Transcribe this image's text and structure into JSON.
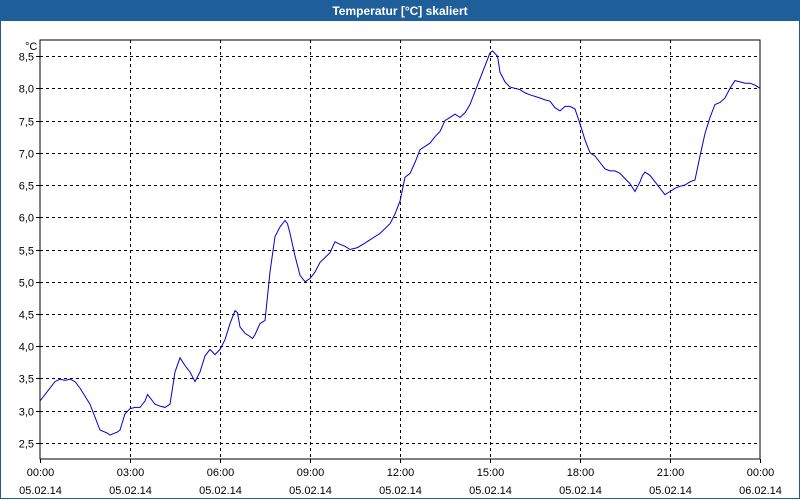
{
  "window": {
    "title": "Temperatur [°C] skaliert"
  },
  "chart_data": {
    "type": "line",
    "title": "Temperatur [°C] skaliert",
    "ylabel": "°C",
    "xlabel": "",
    "ylim": [
      2.25,
      8.75
    ],
    "xlim": [
      "05.02.14 00:00",
      "06.02.14 00:00"
    ],
    "grid": true,
    "yticks": [
      "2,5",
      "3,0",
      "3,5",
      "4,0",
      "4,5",
      "5,0",
      "5,5",
      "6,0",
      "6,5",
      "7,0",
      "7,5",
      "8,0",
      "8,5"
    ],
    "xticks": [
      {
        "time": "00:00",
        "date": "05.02.14"
      },
      {
        "time": "03:00",
        "date": "05.02.14"
      },
      {
        "time": "06:00",
        "date": "05.02.14"
      },
      {
        "time": "09:00",
        "date": "05.02.14"
      },
      {
        "time": "12:00",
        "date": "05.02.14"
      },
      {
        "time": "15:00",
        "date": "05.02.14"
      },
      {
        "time": "18:00",
        "date": "05.02.14"
      },
      {
        "time": "21:00",
        "date": "05.02.14"
      },
      {
        "time": "00:00",
        "date": "06.02.14"
      }
    ],
    "series": [
      {
        "color": "#0000cc",
        "points": [
          [
            "00:00",
            3.15
          ],
          [
            "00:15",
            3.3
          ],
          [
            "00:30",
            3.45
          ],
          [
            "00:40",
            3.49
          ],
          [
            "00:50",
            3.47
          ],
          [
            "01:00",
            3.49
          ],
          [
            "01:10",
            3.45
          ],
          [
            "01:20",
            3.35
          ],
          [
            "01:40",
            3.1
          ],
          [
            "02:00",
            2.7
          ],
          [
            "02:15",
            2.65
          ],
          [
            "02:20",
            2.62
          ],
          [
            "02:35",
            2.67
          ],
          [
            "02:40",
            2.7
          ],
          [
            "02:50",
            2.95
          ],
          [
            "03:00",
            3.03
          ],
          [
            "03:10",
            3.05
          ],
          [
            "03:20",
            3.05
          ],
          [
            "03:30",
            3.15
          ],
          [
            "03:35",
            3.25
          ],
          [
            "03:50",
            3.1
          ],
          [
            "04:00",
            3.07
          ],
          [
            "04:10",
            3.05
          ],
          [
            "04:20",
            3.1
          ],
          [
            "04:30",
            3.6
          ],
          [
            "04:40",
            3.82
          ],
          [
            "04:50",
            3.7
          ],
          [
            "05:00",
            3.6
          ],
          [
            "05:10",
            3.45
          ],
          [
            "05:20",
            3.6
          ],
          [
            "05:30",
            3.85
          ],
          [
            "05:40",
            3.95
          ],
          [
            "05:50",
            3.87
          ],
          [
            "06:00",
            3.95
          ],
          [
            "06:10",
            4.1
          ],
          [
            "06:20",
            4.35
          ],
          [
            "06:30",
            4.55
          ],
          [
            "06:35",
            4.52
          ],
          [
            "06:40",
            4.3
          ],
          [
            "06:50",
            4.2
          ],
          [
            "07:00",
            4.15
          ],
          [
            "07:05",
            4.12
          ],
          [
            "07:10",
            4.18
          ],
          [
            "07:20",
            4.35
          ],
          [
            "07:30",
            4.4
          ],
          [
            "07:40",
            5.15
          ],
          [
            "07:50",
            5.7
          ],
          [
            "08:00",
            5.85
          ],
          [
            "08:10",
            5.95
          ],
          [
            "08:15",
            5.9
          ],
          [
            "08:20",
            5.75
          ],
          [
            "08:30",
            5.4
          ],
          [
            "08:40",
            5.1
          ],
          [
            "08:50",
            5.0
          ],
          [
            "09:00",
            5.05
          ],
          [
            "09:10",
            5.15
          ],
          [
            "09:20",
            5.3
          ],
          [
            "09:40",
            5.45
          ],
          [
            "09:50",
            5.62
          ],
          [
            "10:00",
            5.58
          ],
          [
            "10:10",
            5.55
          ],
          [
            "10:20",
            5.5
          ],
          [
            "10:35",
            5.53
          ],
          [
            "10:50",
            5.6
          ],
          [
            "11:00",
            5.65
          ],
          [
            "11:20",
            5.75
          ],
          [
            "11:40",
            5.9
          ],
          [
            "11:50",
            6.05
          ],
          [
            "12:00",
            6.25
          ],
          [
            "12:10",
            6.62
          ],
          [
            "12:20",
            6.68
          ],
          [
            "12:30",
            6.85
          ],
          [
            "12:40",
            7.05
          ],
          [
            "12:50",
            7.1
          ],
          [
            "13:00",
            7.15
          ],
          [
            "13:10",
            7.25
          ],
          [
            "13:20",
            7.33
          ],
          [
            "13:30",
            7.5
          ],
          [
            "13:40",
            7.55
          ],
          [
            "13:50",
            7.6
          ],
          [
            "14:00",
            7.55
          ],
          [
            "14:10",
            7.62
          ],
          [
            "14:20",
            7.75
          ],
          [
            "14:30",
            7.95
          ],
          [
            "14:40",
            8.15
          ],
          [
            "14:50",
            8.35
          ],
          [
            "15:00",
            8.55
          ],
          [
            "15:05",
            8.58
          ],
          [
            "15:15",
            8.5
          ],
          [
            "15:20",
            8.25
          ],
          [
            "15:30",
            8.1
          ],
          [
            "15:40",
            8.02
          ],
          [
            "15:50",
            8.0
          ],
          [
            "16:00",
            7.98
          ],
          [
            "16:10",
            7.93
          ],
          [
            "16:20",
            7.9
          ],
          [
            "16:40",
            7.85
          ],
          [
            "16:50",
            7.82
          ],
          [
            "17:00",
            7.8
          ],
          [
            "17:10",
            7.7
          ],
          [
            "17:20",
            7.65
          ],
          [
            "17:30",
            7.72
          ],
          [
            "17:40",
            7.72
          ],
          [
            "17:50",
            7.68
          ],
          [
            "18:00",
            7.45
          ],
          [
            "18:10",
            7.2
          ],
          [
            "18:20",
            7.0
          ],
          [
            "18:30",
            6.95
          ],
          [
            "18:40",
            6.85
          ],
          [
            "18:50",
            6.75
          ],
          [
            "19:00",
            6.72
          ],
          [
            "19:10",
            6.72
          ],
          [
            "19:20",
            6.68
          ],
          [
            "19:30",
            6.6
          ],
          [
            "19:40",
            6.52
          ],
          [
            "19:50",
            6.4
          ],
          [
            "20:00",
            6.55
          ],
          [
            "20:05",
            6.65
          ],
          [
            "20:10",
            6.7
          ],
          [
            "20:20",
            6.65
          ],
          [
            "20:30",
            6.55
          ],
          [
            "20:40",
            6.45
          ],
          [
            "20:50",
            6.35
          ],
          [
            "21:00",
            6.4
          ],
          [
            "21:10",
            6.45
          ],
          [
            "21:20",
            6.48
          ],
          [
            "21:30",
            6.5
          ],
          [
            "21:40",
            6.55
          ],
          [
            "21:50",
            6.58
          ],
          [
            "22:00",
            6.95
          ],
          [
            "22:10",
            7.3
          ],
          [
            "22:20",
            7.55
          ],
          [
            "22:30",
            7.75
          ],
          [
            "22:40",
            7.78
          ],
          [
            "22:50",
            7.85
          ],
          [
            "23:00",
            8.0
          ],
          [
            "23:10",
            8.12
          ],
          [
            "23:20",
            8.1
          ],
          [
            "23:30",
            8.08
          ],
          [
            "23:40",
            8.08
          ],
          [
            "23:50",
            8.05
          ],
          [
            "24:00",
            8.0
          ]
        ]
      }
    ]
  }
}
